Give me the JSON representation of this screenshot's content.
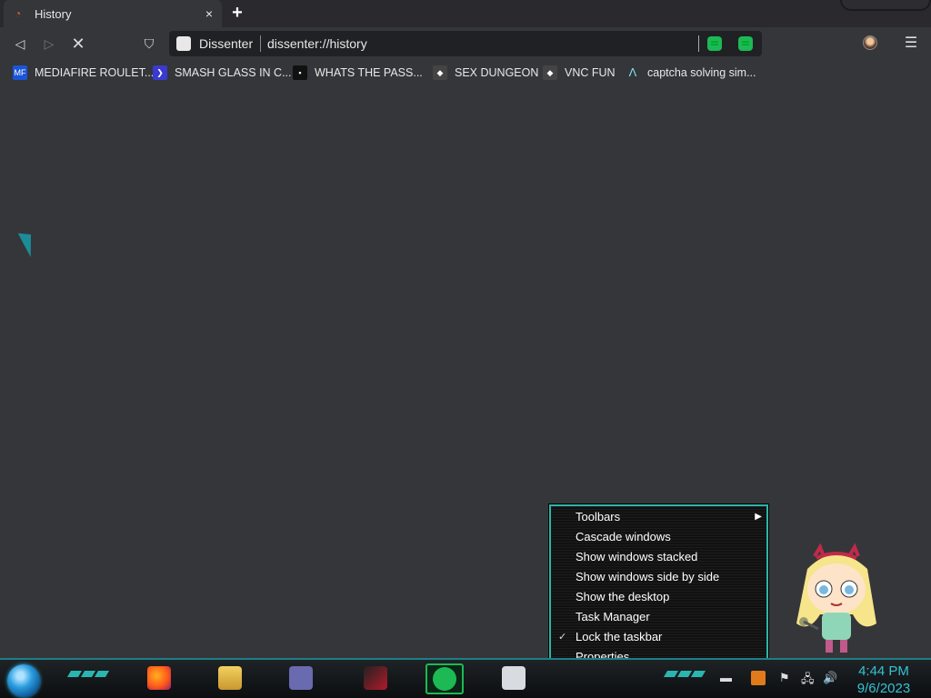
{
  "tab": {
    "title": "History",
    "close": "×"
  },
  "new_tab_label": "+",
  "nav": {
    "back": "◁",
    "forward": "▷",
    "reload": "✕",
    "bookmark": "⛉",
    "menu": "☰"
  },
  "omnibox": {
    "site_name": "Dissenter",
    "url": "dissenter://history"
  },
  "bookmarks": [
    {
      "label": "MEDIAFIRE ROULET...",
      "icon": "mediafire-icon",
      "icon_text": "MF",
      "color": "#1a55d8"
    },
    {
      "label": "SMASH GLASS IN C...",
      "icon": "chevron-icon",
      "icon_text": "❯",
      "color": "#3a3ad0"
    },
    {
      "label": "WHATS THE PASS...",
      "icon": "lock-icon",
      "icon_text": "▪",
      "color": "#111111"
    },
    {
      "label": "SEX DUNGEON",
      "icon": "cube-icon",
      "icon_text": "◆",
      "color": "#444444"
    },
    {
      "label": "VNC FUN",
      "icon": "cube-icon",
      "icon_text": "◆",
      "color": "#444444"
    },
    {
      "label": "captcha solving sim...",
      "icon": "a-logo-icon",
      "icon_text": "Λ",
      "color": "#353639"
    }
  ],
  "context_menu": [
    {
      "label": "Toolbars",
      "has_submenu": true,
      "checked": false
    },
    {
      "label": "Cascade windows",
      "has_submenu": false,
      "checked": false
    },
    {
      "label": "Show windows stacked",
      "has_submenu": false,
      "checked": false
    },
    {
      "label": "Show windows side by side",
      "has_submenu": false,
      "checked": false
    },
    {
      "label": "Show the desktop",
      "has_submenu": false,
      "checked": false
    },
    {
      "label": "Task Manager",
      "has_submenu": false,
      "checked": false
    },
    {
      "label": "Lock the taskbar",
      "has_submenu": false,
      "checked": true
    },
    {
      "label": "Properties",
      "has_submenu": false,
      "checked": false
    }
  ],
  "taskbar": {
    "apps": [
      {
        "name": "firefox",
        "color": "#ff7a1a"
      },
      {
        "name": "file-explorer",
        "color": "#e8c050"
      },
      {
        "name": "window-app",
        "color": "#6a6ab0"
      },
      {
        "name": "red-app",
        "color": "#b01a2a"
      },
      {
        "name": "dissenter",
        "color": "#1db954"
      },
      {
        "name": "notepad",
        "color": "#d8dce0"
      }
    ],
    "clock_time": "4:44 PM",
    "clock_date": "9/6/2023"
  }
}
